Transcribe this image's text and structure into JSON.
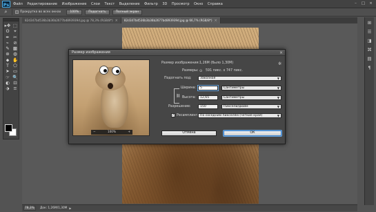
{
  "app": {
    "logo": "Ps"
  },
  "menu": [
    "Файл",
    "Редактирование",
    "Изображение",
    "Слои",
    "Текст",
    "Выделение",
    "Фильтр",
    "3D",
    "Просмотр",
    "Окно",
    "Справка"
  ],
  "window_controls": [
    "–",
    "□",
    "×"
  ],
  "options_bar": {
    "tool_icon": "zoom-icon",
    "checkboxes": [
      {
        "label": "Прокрутка во всех окнах",
        "checked": false
      }
    ],
    "buttons": [
      "100%",
      "Подогнать",
      "Полный экран"
    ]
  },
  "tabs": [
    {
      "label": "82d347bd536b3b36b2677bd893939d.jpg @ 78,3% (RGB/8*)",
      "active": false
    },
    {
      "label": "82d347bd536b3b36b2677bd893939d.jpg @ 66,7% (RGB/8*)",
      "active": true
    }
  ],
  "tools": [
    "▸✥",
    "⬚",
    "ʘ",
    "⌖",
    "✒",
    "✂",
    "⌁",
    "⊘",
    "✎",
    "▩",
    "⊛",
    "◍",
    "⬥",
    "✋",
    "T",
    "⬠",
    "➤",
    "▭",
    "☞",
    "🔍",
    "◐",
    "⊡",
    "⬗",
    "≡"
  ],
  "right_panel_icons": [
    "⊞",
    "☰",
    "◨",
    "⌘",
    "▤",
    "¶"
  ],
  "statusbar": {
    "zoom": "78,3%",
    "doc": "Док: 1,26M/1,30M"
  },
  "dialog": {
    "title": "Размер изображения",
    "image_size_label": "Размер изображения:",
    "image_size_value": "1,26M (было 1,30M)",
    "dimensions_label": "Размеры:",
    "dimensions_value": "591 пикс. x 747 пикс.",
    "fit_label": "Подогнать под:",
    "fit_value": "Заказная",
    "width_label": "Ширина:",
    "width_value": "5",
    "width_unit": "Сантиметры",
    "height_label": "Высота:",
    "height_value": "12,65",
    "height_unit": "Сантиметры",
    "resolution_label": "Разрешение:",
    "resolution_value": "150",
    "resolution_unit": "Пиксели/дюйм",
    "resample_label": "Ресамплинг:",
    "resample_checked": true,
    "resample_value": "По соседним пикселям (четкие края)",
    "preview_zoom": "100%",
    "cancel": "Отмена",
    "ok": "ОК"
  }
}
